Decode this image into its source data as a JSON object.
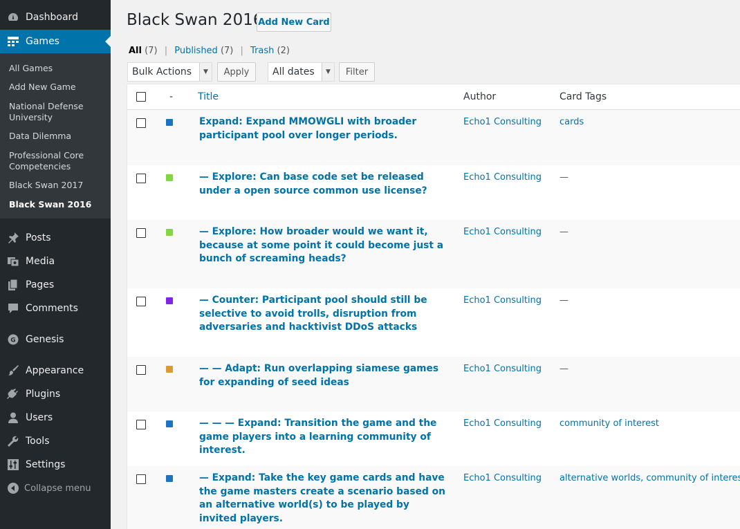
{
  "sidebar": {
    "dashboard": "Dashboard",
    "games": "Games",
    "submenu": [
      "All Games",
      "Add New Game",
      "National Defense University",
      "Data Dilemma",
      "Professional Core Competencies",
      "Black Swan 2017",
      "Black Swan 2016"
    ],
    "posts": "Posts",
    "media": "Media",
    "pages": "Pages",
    "comments": "Comments",
    "genesis": "Genesis",
    "appearance": "Appearance",
    "plugins": "Plugins",
    "users": "Users",
    "tools": "Tools",
    "settings": "Settings",
    "collapse": "Collapse menu"
  },
  "header": {
    "title": "Black Swan 2016",
    "add_new": "Add New Card"
  },
  "views": {
    "all": "All",
    "all_count": "(7)",
    "published": "Published",
    "published_count": "(7)",
    "trash": "Trash",
    "trash_count": "(2)"
  },
  "actions": {
    "bulk": "Bulk Actions",
    "apply": "Apply",
    "dates": "All dates",
    "filter": "Filter"
  },
  "table": {
    "col_dash": "-",
    "col_title": "Title",
    "col_author": "Author",
    "col_tags": "Card Tags",
    "rows": [
      {
        "color": "#1e73be",
        "title": "Expand: Expand MMOWGLI with broader participant pool over longer periods.",
        "author": "Echo1 Consulting",
        "tags": "cards"
      },
      {
        "color": "#81d742",
        "title": "— Explore: Can base code set be released under a open source common use license?",
        "author": "Echo1 Consulting",
        "tags": "—"
      },
      {
        "color": "#81d742",
        "title": "— Explore: How broader would we want it, because at some point it could become just a bunch of screaming heads?",
        "author": "Echo1 Consulting",
        "tags": "—"
      },
      {
        "color": "#8224e3",
        "title": "— Counter: Participant pool should still be selective to avoid trolls, disruption from adversaries and hacktivist DDoS attacks",
        "author": "Echo1 Consulting",
        "tags": "—"
      },
      {
        "color": "#dd9933",
        "title": "— — Adapt: Run overlapping siamese games for expanding of seed ideas",
        "author": "Echo1 Consulting",
        "tags": "—"
      },
      {
        "color": "#1e73be",
        "title": "— — — Expand: Transition the game and the game players into a learning community of interest.",
        "author": "Echo1 Consulting",
        "tags": "community of interest"
      },
      {
        "color": "#1e73be",
        "title": "— Expand: Take the key game cards and have the game masters create a scenario based on an alternative world(s) to be played by invited players.",
        "author": "Echo1 Consulting",
        "tags": "alternative worlds, community of interest"
      }
    ]
  }
}
